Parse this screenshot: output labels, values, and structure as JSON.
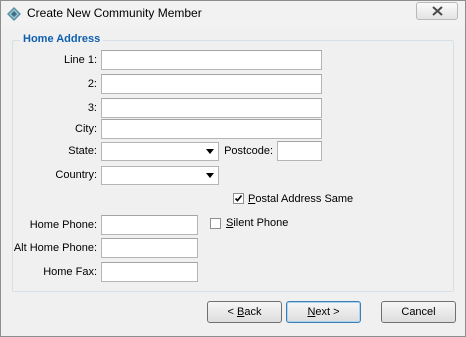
{
  "window": {
    "title": "Create New Community Member"
  },
  "group": {
    "legend": "Home Address"
  },
  "fields": {
    "line1": {
      "label": "Line 1:",
      "value": ""
    },
    "line2": {
      "label": "2:",
      "value": ""
    },
    "line3": {
      "label": "3:",
      "value": ""
    },
    "city": {
      "label": "City:",
      "value": ""
    },
    "state": {
      "label": "State:",
      "value": ""
    },
    "postcode": {
      "label": "Postcode:",
      "value": ""
    },
    "country": {
      "label": "Country:",
      "value": ""
    },
    "home_phone": {
      "label": "Home Phone:",
      "value": ""
    },
    "alt_home_phone": {
      "label": "Alt Home Phone:",
      "value": ""
    },
    "home_fax": {
      "label": "Home Fax:",
      "value": ""
    }
  },
  "checkboxes": {
    "postal_same": {
      "label_pre": "",
      "label_ul": "P",
      "label_post": "ostal Address Same",
      "checked": true
    },
    "silent_phone": {
      "label_pre": "",
      "label_ul": "S",
      "label_post": "ilent Phone",
      "checked": false
    }
  },
  "buttons": {
    "back": {
      "pre": "< ",
      "ul": "B",
      "post": "ack"
    },
    "next": {
      "pre": "",
      "ul": "N",
      "post": "ext >"
    },
    "cancel": {
      "label": "Cancel"
    }
  },
  "icons": {
    "app": "diamond-app-icon",
    "close": "close-icon",
    "dropdown": "chevron-down-icon",
    "check": "checkmark-icon"
  }
}
